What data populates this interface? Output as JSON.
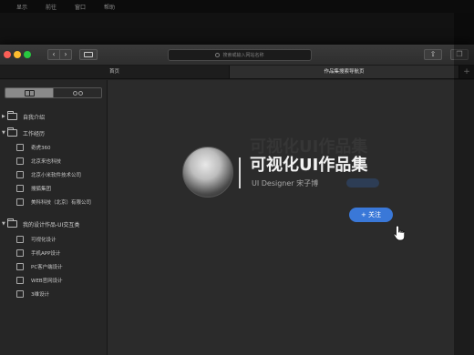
{
  "menubar": {
    "items": [
      "显示",
      "前往",
      "窗口",
      "帮助"
    ]
  },
  "browser": {
    "address_placeholder": "搜索或输入网站名称",
    "tabs": [
      {
        "label": "首页",
        "active": false
      },
      {
        "label": "作品集搜索导航页",
        "active": true
      }
    ],
    "new_tab": "+"
  },
  "sidebar": {
    "folders": [
      {
        "label": "自我介绍",
        "expanded": false,
        "items": []
      },
      {
        "label": "工作经历",
        "expanded": true,
        "items": [
          "奇虎360",
          "北京来也科技",
          "北京小米软件技术公司",
          "搜狐集团",
          "美科科技（北京）有限公司"
        ]
      },
      {
        "label": "我的设计作品-UI交互类",
        "expanded": true,
        "items": [
          "可视化设计",
          "手机APP设计",
          "PC客户端设计",
          "WEB官网设计",
          "3维设计"
        ]
      }
    ]
  },
  "hero": {
    "ghost_title": "可视化UI作品集",
    "title": "可视化UI作品集",
    "subtitle": "UI Designer  宋子博",
    "follow_label": "+ 关注"
  },
  "colors": {
    "accent": "#3a78d8",
    "traffic_red": "#fc5f57",
    "traffic_yellow": "#fdbc2e",
    "traffic_green": "#28c840"
  }
}
